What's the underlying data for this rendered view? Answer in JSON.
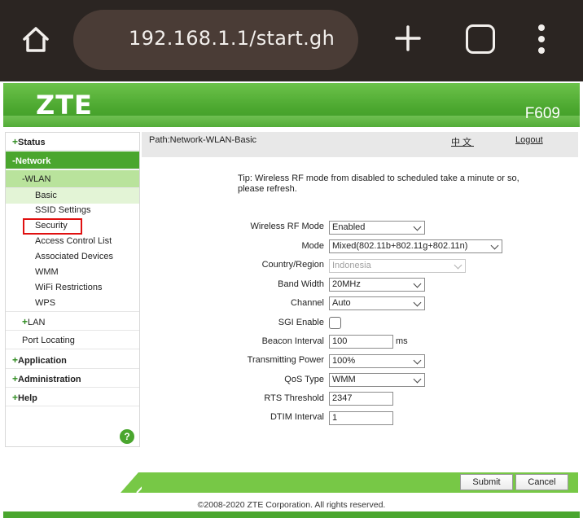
{
  "browser": {
    "url": "192.168.1.1/start.gh"
  },
  "header": {
    "logo": "ZTE",
    "model": "F609"
  },
  "sidebar": {
    "items": [
      {
        "prefix": "+",
        "label": "Status"
      },
      {
        "prefix": "-",
        "label": "Network"
      },
      {
        "prefix": "-",
        "label": "WLAN"
      },
      {
        "label": "Basic"
      },
      {
        "label": "SSID Settings"
      },
      {
        "label": "Security"
      },
      {
        "label": "Access Control List"
      },
      {
        "label": "Associated Devices"
      },
      {
        "label": "WMM"
      },
      {
        "label": "WiFi Restrictions"
      },
      {
        "label": "WPS"
      },
      {
        "prefix": "+",
        "label": "LAN"
      },
      {
        "label": "Port Locating"
      },
      {
        "prefix": "+",
        "label": "Application"
      },
      {
        "prefix": "+",
        "label": "Administration"
      },
      {
        "prefix": "+",
        "label": "Help"
      }
    ],
    "help_icon": "?"
  },
  "main": {
    "path": "Path:Network-WLAN-Basic",
    "lang_link": "中文",
    "logout": "Logout",
    "tip": "Tip: Wireless RF mode from disabled to scheduled take a minute or so, please refresh.",
    "fields": {
      "rf_mode": {
        "label": "Wireless RF Mode",
        "value": "Enabled"
      },
      "mode": {
        "label": "Mode",
        "value": "Mixed(802.11b+802.11g+802.11n)"
      },
      "country": {
        "label": "Country/Region",
        "value": "Indonesia"
      },
      "bandwidth": {
        "label": "Band Width",
        "value": "20MHz"
      },
      "channel": {
        "label": "Channel",
        "value": "Auto"
      },
      "sgi": {
        "label": "SGI Enable",
        "checked": false
      },
      "beacon": {
        "label": "Beacon Interval",
        "value": "100",
        "unit": "ms"
      },
      "tx_power": {
        "label": "Transmitting Power",
        "value": "100%"
      },
      "qos": {
        "label": "QoS Type",
        "value": "WMM"
      },
      "rts": {
        "label": "RTS Threshold",
        "value": "2347"
      },
      "dtim": {
        "label": "DTIM Interval",
        "value": "1"
      }
    },
    "submit": "Submit",
    "cancel": "Cancel"
  },
  "footer": {
    "copyright": "©2008-2020 ZTE Corporation. All rights reserved."
  },
  "colors": {
    "brand_green": "#4aa62e",
    "wlan_highlight": "#b9e39c",
    "basic_highlight": "#e3f4d6",
    "security_outline": "#e01010",
    "browser_bar": "#2b2522"
  }
}
